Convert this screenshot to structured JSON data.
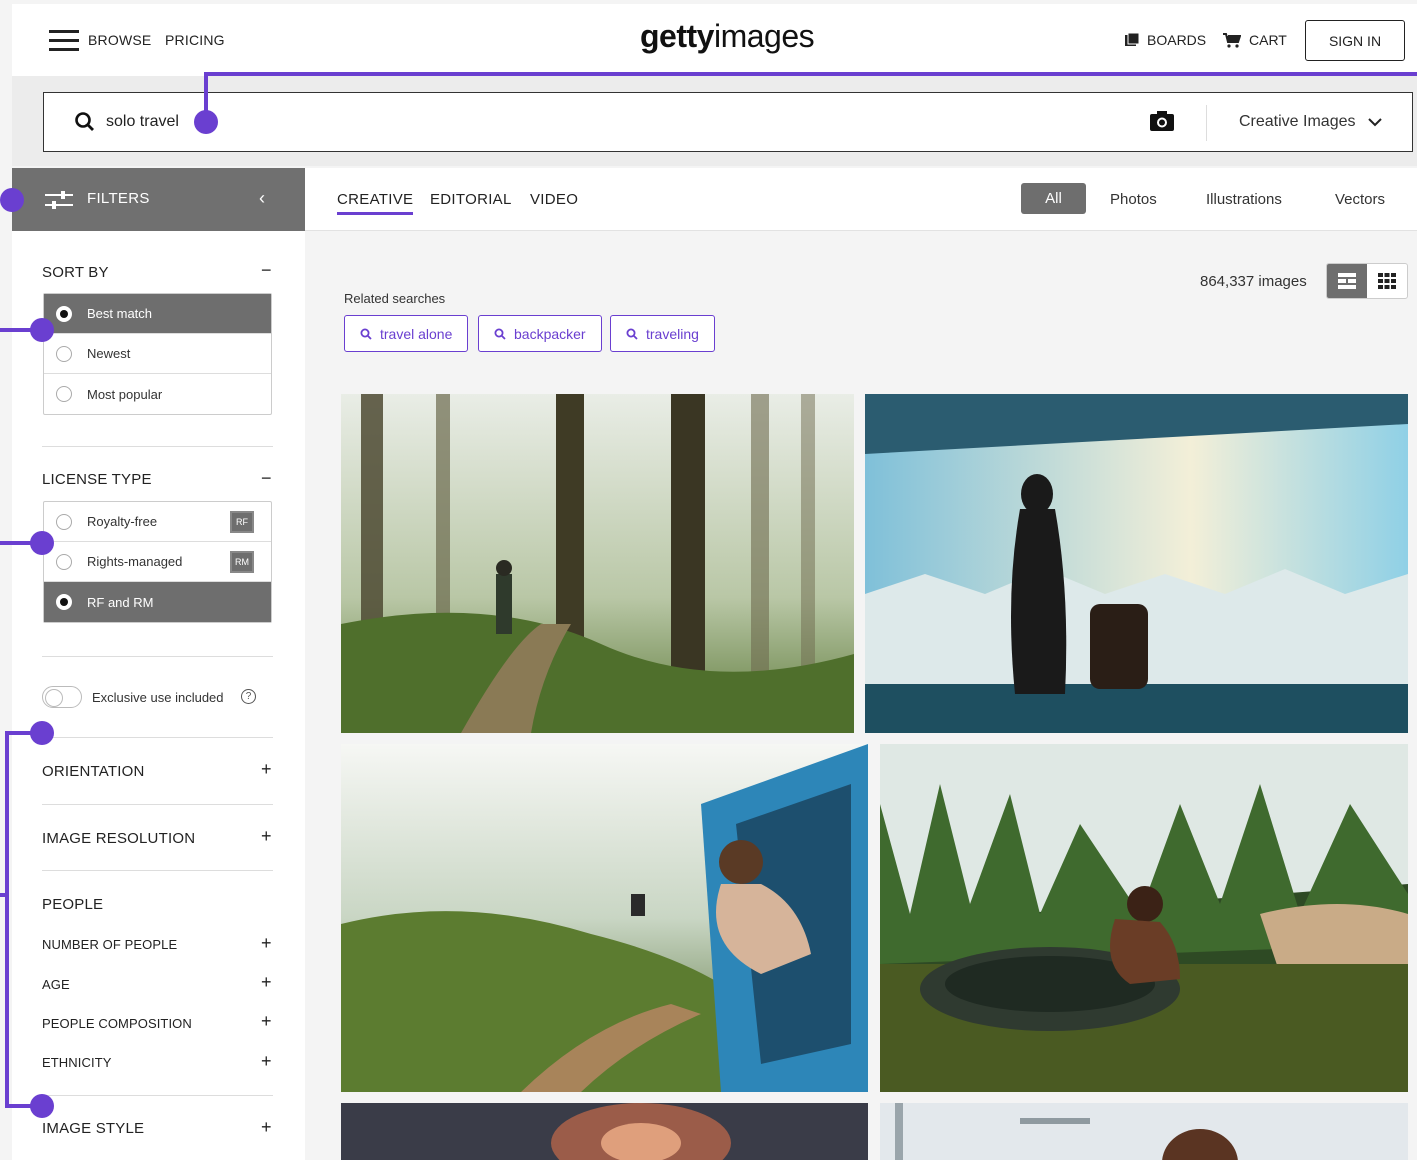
{
  "header": {
    "browse_label": "BROWSE",
    "pricing_label": "PRICING",
    "logo_bold": "getty",
    "logo_light": "images",
    "boards_label": "BOARDS",
    "cart_label": "CART",
    "signin_label": "SIGN IN"
  },
  "search": {
    "query": "solo travel",
    "scope": "Creative Images"
  },
  "filters": {
    "title": "FILTERS",
    "sort_by": {
      "title": "SORT BY",
      "options": [
        {
          "label": "Best match",
          "selected": true
        },
        {
          "label": "Newest",
          "selected": false
        },
        {
          "label": "Most popular",
          "selected": false
        }
      ]
    },
    "license_type": {
      "title": "LICENSE TYPE",
      "options": [
        {
          "label": "Royalty-free",
          "badge": "RF",
          "selected": false
        },
        {
          "label": "Rights-managed",
          "badge": "RM",
          "selected": false
        },
        {
          "label": "RF and RM",
          "selected": true
        }
      ]
    },
    "exclusive_label": "Exclusive use included",
    "help_glyph": "?",
    "orientation": "ORIENTATION",
    "image_resolution": "IMAGE RESOLUTION",
    "people": {
      "title": "PEOPLE",
      "items": [
        "NUMBER OF PEOPLE",
        "AGE",
        "PEOPLE COMPOSITION",
        "ETHNICITY"
      ]
    },
    "image_style": "IMAGE STYLE"
  },
  "tabs": {
    "creative": "CREATIVE",
    "editorial": "EDITORIAL",
    "video": "VIDEO"
  },
  "media_types": {
    "all": "All",
    "photos": "Photos",
    "illustrations": "Illustrations",
    "vectors": "Vectors"
  },
  "results": {
    "count": "864,337 images",
    "related_label": "Related searches",
    "related": [
      "travel alone",
      "backpacker",
      "traveling"
    ]
  },
  "colors": {
    "accent": "#6a3fd0",
    "selected_gray": "#6e6e6e"
  }
}
